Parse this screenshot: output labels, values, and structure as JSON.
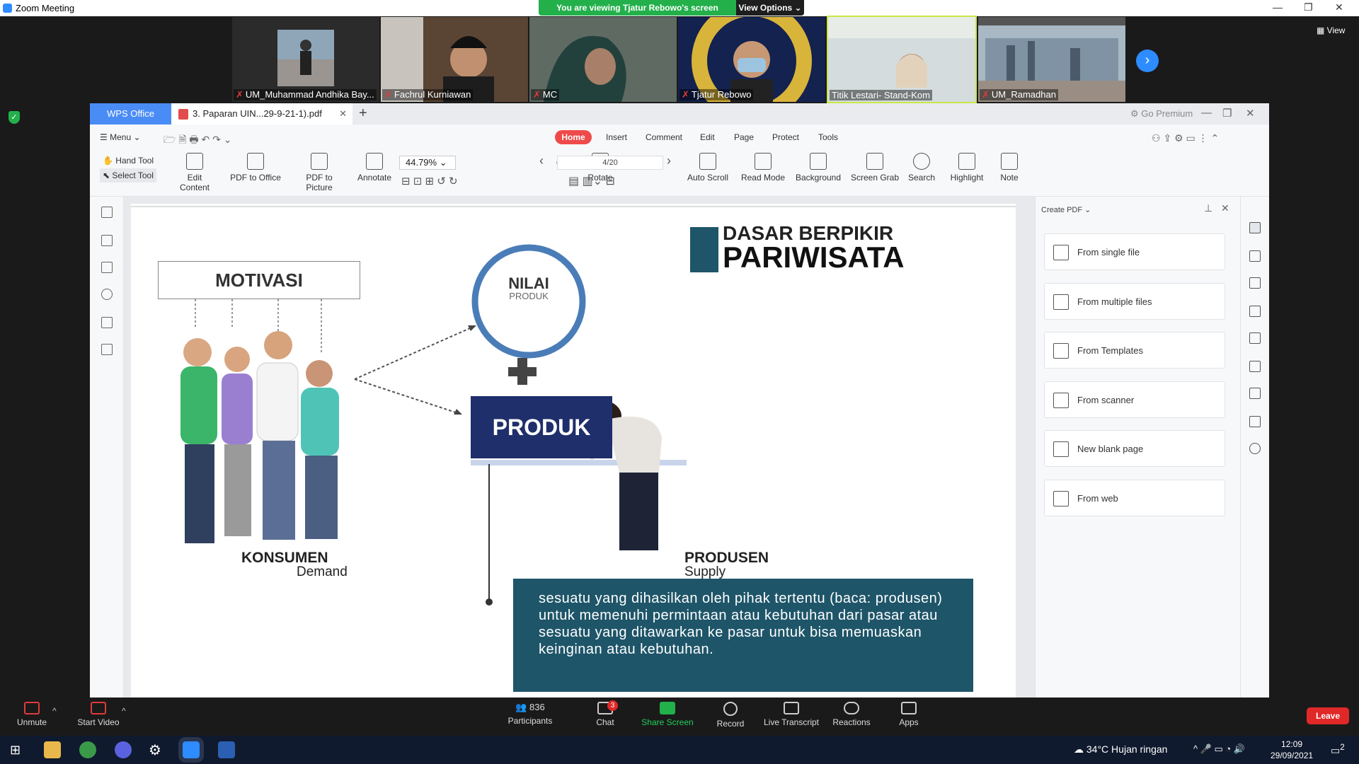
{
  "window": {
    "title": "Zoom Meeting"
  },
  "banner": {
    "message": "You are viewing Tjatur Rebowo's screen",
    "options": "View Options ⌄"
  },
  "view_label": "View",
  "participants": [
    {
      "name": "UM_Muhammad Andhika Bay...",
      "muted": true
    },
    {
      "name": "Fachrul Kurniawan",
      "muted": true
    },
    {
      "name": "MC",
      "muted": true
    },
    {
      "name": "Tjatur Rebowo",
      "muted": true
    },
    {
      "name": "Titik Lestari- Stand-Kom",
      "muted": false
    },
    {
      "name": "UM_Ramadhan",
      "muted": true
    }
  ],
  "wps": {
    "office_tab": "WPS Office",
    "doc_tab": "3. Paparan UIN...29-9-21-1).pdf",
    "go_premium": "Go Premium",
    "menu_label": "Menu",
    "tabs": [
      "Home",
      "Insert",
      "Comment",
      "Edit",
      "Page",
      "Protect",
      "Tools"
    ],
    "hand_tool": "Hand Tool",
    "select_tool": "Select Tool",
    "tools": [
      "Edit Content",
      "PDF to Office",
      "PDF to Picture",
      "Annotate",
      "Rotate",
      "Auto Scroll",
      "Read Mode",
      "Background",
      "Screen Grab",
      "Search",
      "Highlight",
      "Note"
    ],
    "zoom": "44.79%",
    "page": "4/20"
  },
  "create_pdf": {
    "header": "Create PDF",
    "items": [
      "From single file",
      "From multiple files",
      "From Templates",
      "From scanner",
      "New blank page",
      "From web"
    ]
  },
  "slide": {
    "title_small": "DASAR BERPIKIR",
    "title_big": "PARIWISATA",
    "motivasi": "MOTIVASI",
    "nilai": "NILAI",
    "produk_small": "PRODUK",
    "produk": "PRODUK",
    "konsumen": "KONSUMEN",
    "demand": "Demand",
    "produsen": "PRODUSEN",
    "supply": "Supply",
    "definition": "sesuatu yang dihasilkan oleh pihak tertentu (baca: produsen) untuk memenuhi permintaan atau kebutuhan dari pasar atau sesuatu yang ditawarkan ke pasar untuk bisa memuaskan keinginan atau kebutuhan."
  },
  "controls": {
    "unmute": "Unmute",
    "start_video": "Start Video",
    "participants": "Participants",
    "participant_count": "836",
    "chat": "Chat",
    "chat_badge": "3",
    "share_screen": "Share Screen",
    "record": "Record",
    "live_transcript": "Live Transcript",
    "reactions": "Reactions",
    "apps": "Apps",
    "leave": "Leave"
  },
  "taskbar": {
    "weather": "34°C  Hujan ringan",
    "time": "12:09",
    "date": "29/09/2021",
    "notif": "2"
  },
  "colors": {
    "zoom_blue": "#2d8cff",
    "share_green": "#23b04b",
    "wps_blue": "#4a8cf6",
    "home_red": "#ef4a4a",
    "slide_navy": "#1f2f6b",
    "slide_teal": "#1e5569",
    "leave_red": "#e02828"
  }
}
